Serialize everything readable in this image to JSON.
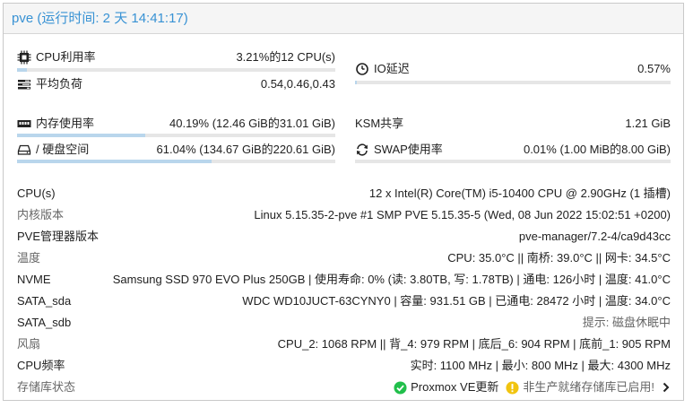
{
  "header": {
    "title": "pve (运行时间: 2 天 14:41:17)"
  },
  "stats": {
    "cpu": {
      "label": "CPU利用率",
      "value": "3.21%的12 CPU(s)",
      "usage_fraction": 0.0321,
      "icon": "cpu-chip-icon"
    },
    "load": {
      "label": "平均负荷",
      "value": "0.54,0.46,0.43",
      "icon": "load-tasks-icon"
    },
    "io": {
      "label": "IO延迟",
      "value": "0.57%",
      "usage_fraction": 0.0057,
      "icon": "clock-icon"
    },
    "memory": {
      "label": "内存使用率",
      "value": "40.19% (12.46 GiB的31.01 GiB)",
      "usage_fraction": 0.4019,
      "icon": "memory-icon"
    },
    "ksm": {
      "label": "KSM共享",
      "value": "1.21 GiB"
    },
    "disk": {
      "label": "/ 硬盘空间",
      "value": "61.04% (134.67 GiB的220.61 GiB)",
      "usage_fraction": 0.6104,
      "icon": "hdd-icon"
    },
    "swap": {
      "label": "SWAP使用率",
      "value": "0.01% (1.00 MiB的8.00 GiB)",
      "usage_fraction": 0.0001,
      "icon": "swap-refresh-icon"
    }
  },
  "info": {
    "cpu_model": {
      "label": "CPU(s)",
      "value": "12 x Intel(R) Core(TM) i5-10400 CPU @ 2.90GHz (1 插槽)"
    },
    "kernel": {
      "label": "内核版本",
      "value": "Linux 5.15.35-2-pve #1 SMP PVE 5.15.35-5 (Wed, 08 Jun 2022 15:02:51 +0200)"
    },
    "pve_manager": {
      "label": "PVE管理器版本",
      "value": "pve-manager/7.2-4/ca9d43cc"
    },
    "temperature": {
      "label": "温度",
      "value": "CPU: 35.0°C || 南桥: 39.0°C || 网卡: 34.5°C"
    },
    "nvme": {
      "label": "NVME",
      "value": "Samsung SSD 970 EVO Plus 250GB | 使用寿命: 0% (读: 3.80TB, 写: 1.78TB) | 通电: 126小时 | 温度: 41.0°C"
    },
    "sata_sda": {
      "label": "SATA_sda",
      "value": "WDC WD10JUCT-63CYNY0 | 容量: 931.51 GB | 已通电: 28472 小时 | 温度: 34.0°C"
    },
    "sata_sdb": {
      "label": "SATA_sdb",
      "value": "提示: 磁盘休眠中"
    },
    "fans": {
      "label": "风扇",
      "value": "CPU_2: 1068 RPM || 背_4: 979 RPM | 底后_6: 904 RPM | 底前_1: 905 RPM"
    },
    "cpu_freq": {
      "label": "CPU频率",
      "value": "实时: 1100 MHz | 最小: 800 MHz | 最大: 4300 MHz"
    },
    "repo": {
      "label": "存储库状态",
      "ok_text": "Proxmox VE更新",
      "warn_text": "非生产就绪存储库已启用!"
    }
  },
  "colors": {
    "accent": "#3892d4",
    "bar_fill": "#b9d6ec",
    "ok": "#21bf4b",
    "warn": "#f1c40f"
  }
}
